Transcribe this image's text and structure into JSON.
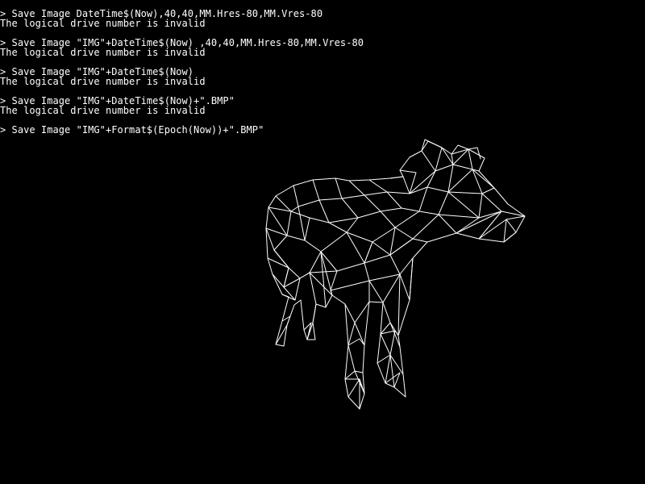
{
  "console": {
    "lines": [
      "> Save Image DateTime$(Now),40,40,MM.Hres-80,MM.Vres-80",
      "The logical drive number is invalid",
      "",
      "> Save Image \"IMG\"+DateTime$(Now) ,40,40,MM.Hres-80,MM.Vres-80",
      "The logical drive number is invalid",
      "",
      "> Save Image \"IMG\"+DateTime$(Now)",
      "The logical drive number is invalid",
      "",
      "> Save Image \"IMG\"+DateTime$(Now)+\".BMP\"",
      "The logical drive number is invalid",
      "",
      "> Save Image \"IMG\"+Format$(Epoch(Now))+\".BMP\""
    ]
  },
  "colors": {
    "background": "#000000",
    "foreground": "#ffffff"
  },
  "graphic": {
    "icon": "cow-wireframe-icon"
  }
}
